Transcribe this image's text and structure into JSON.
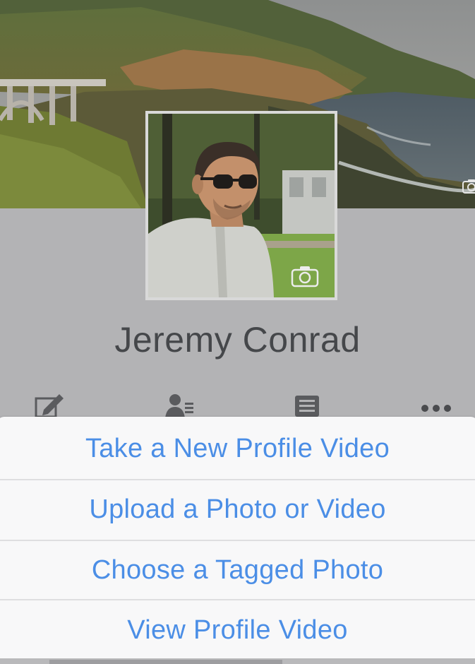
{
  "profile": {
    "name": "Jeremy Conrad"
  },
  "icons": {
    "cover_camera": "camera-icon",
    "profile_camera": "camera-icon",
    "edit": "edit-icon",
    "friends": "friends-icon",
    "activity_log": "activity-log-icon",
    "more": "more-icon"
  },
  "action_sheet": {
    "items": [
      {
        "label": "Take a New Profile Video"
      },
      {
        "label": "Upload a Photo or Video"
      },
      {
        "label": "Choose a Tagged Photo"
      },
      {
        "label": "View Profile Video"
      }
    ]
  },
  "colors": {
    "action_text": "#4b8ee6",
    "sheet_background": "#f8f8f9",
    "page_background": "#b3b3b5",
    "name_text": "#45474a"
  }
}
